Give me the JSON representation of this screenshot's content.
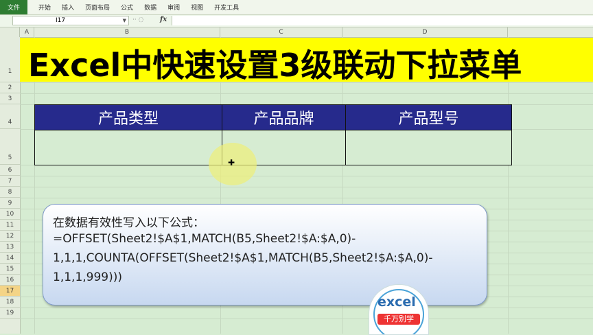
{
  "ribbon": {
    "file_tab": "文件",
    "tabs": [
      "开始",
      "插入",
      "页面布局",
      "公式",
      "数据",
      "审阅",
      "视图",
      "开发工具"
    ]
  },
  "formula_bar": {
    "name_box": "I17",
    "fx_label": "fx",
    "formula": ""
  },
  "columns": [
    "A",
    "B",
    "C",
    "D"
  ],
  "rows": [
    "1",
    "2",
    "3",
    "4",
    "5",
    "6",
    "7",
    "8",
    "9",
    "10",
    "11",
    "12",
    "13",
    "14",
    "15",
    "16",
    "17",
    "18",
    "19"
  ],
  "selected_row": "17",
  "title": "Excel中快速设置3级联动下拉菜单",
  "table": {
    "headers": [
      "产品类型",
      "产品品牌",
      "产品型号"
    ]
  },
  "callout": {
    "lines": [
      "在数据有效性写入以下公式：",
      "=OFFSET(Sheet2!$A$1,MATCH(B5,Sheet2!$A:$A,0)-",
      "1,1,1,COUNTA(OFFSET(Sheet2!$A$1,MATCH(B5,Sheet2!$A:$A,0)-",
      "1,1,1,999)))"
    ]
  },
  "logo": {
    "word": "excel",
    "sub": "千万别学"
  },
  "colors": {
    "title_band": "#ffff00",
    "header_fill": "#262a8c",
    "sheet_bg": "#d6ecd2",
    "file_tab": "#2e7d32"
  }
}
